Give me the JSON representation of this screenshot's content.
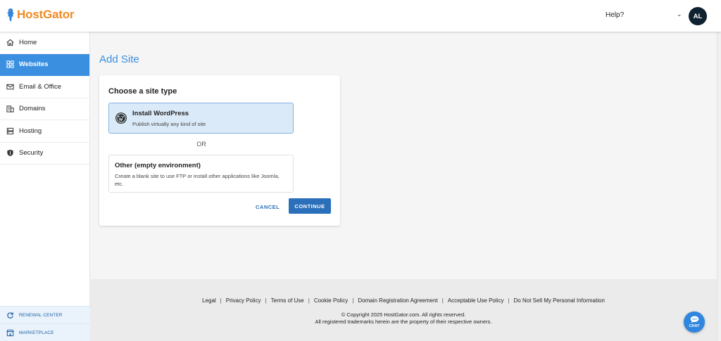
{
  "header": {
    "logo_text": "HostGator",
    "help_label": "Help?",
    "avatar_initials": "AL"
  },
  "sidebar": {
    "items": [
      {
        "label": "Home",
        "icon": "home-icon",
        "active": false
      },
      {
        "label": "Websites",
        "icon": "grid-icon",
        "active": true
      },
      {
        "label": "Email & Office",
        "icon": "mail-icon",
        "active": false
      },
      {
        "label": "Domains",
        "icon": "building-icon",
        "active": false
      },
      {
        "label": "Hosting",
        "icon": "server-icon",
        "active": false
      },
      {
        "label": "Security",
        "icon": "shield-icon",
        "active": false
      }
    ],
    "bottom_links": [
      {
        "label": "RENEWAL CENTER",
        "icon": "refresh-icon"
      },
      {
        "label": "MARKETPLACE",
        "icon": "store-icon"
      }
    ]
  },
  "main": {
    "page_title": "Add Site",
    "card": {
      "title": "Choose a site type",
      "option_wordpress": {
        "title": "Install WordPress",
        "description": "Publish virtually any kind of site",
        "selected": true
      },
      "or_label": "OR",
      "option_other": {
        "title": "Other (empty environment)",
        "description": "Create a blank site to use FTP or install other applications like Joomla, etc.",
        "selected": false
      },
      "cancel_label": "CANCEL",
      "continue_label": "CONTINUE"
    }
  },
  "footer": {
    "links": [
      "Legal",
      "Privacy Policy",
      "Terms of Use",
      "Cookie Policy",
      "Domain Registration Agreement",
      "Acceptable Use Policy",
      "Do Not Sell My Personal Information"
    ],
    "separator": "|",
    "copyright": "© Copyright 2025 HostGator.com. All rights reserved.",
    "trademark": "All registered trademarks herein are the property of their respective owners."
  },
  "chat": {
    "label": "CHAT"
  },
  "colors": {
    "brand_orange": "#f08a24",
    "accent_blue": "#3a8fe0",
    "button_blue": "#2a6fba",
    "selected_option_bg": "#dbeaf8",
    "avatar_bg": "#0f2230"
  }
}
